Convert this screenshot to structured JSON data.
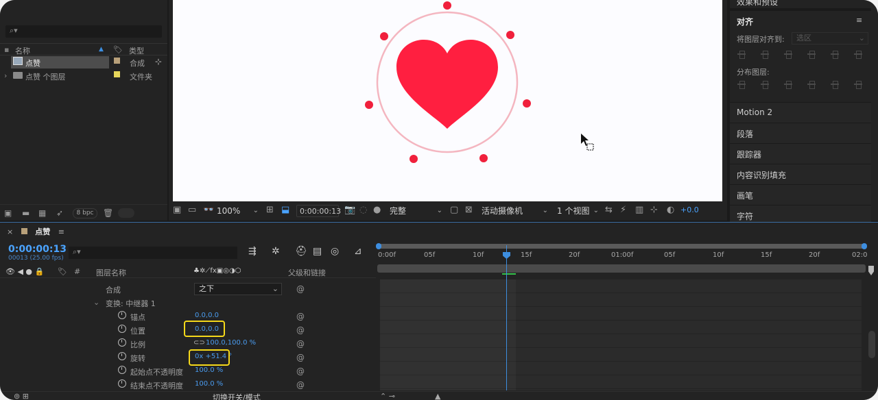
{
  "project": {
    "search_placeholder": "",
    "col_name": "名称",
    "col_type": "类型",
    "items": [
      {
        "name": "点赞",
        "type": "合成",
        "label_color": "#b8a07a"
      },
      {
        "name": "点赞 个图层",
        "type": "文件夹",
        "label_color": "#e6d65a"
      }
    ],
    "bpc": "8 bpc"
  },
  "viewer": {
    "zoom": "100%",
    "timecode": "0:00:00:13",
    "resolution": "完整",
    "camera": "活动摄像机",
    "views": "1 个视图",
    "exposure": "+0.0",
    "heart_color": "#ff1f40",
    "ring_color": "#f4b6c0"
  },
  "right": {
    "top_partial": "效果和预设",
    "align_title": "对齐",
    "align_to_label": "将图层对齐到:",
    "align_to_value": "选区",
    "distribute_label": "分布图层:",
    "sections": [
      "Motion 2",
      "段落",
      "跟踪器",
      "内容识别填充",
      "画笔",
      "字符"
    ]
  },
  "timeline": {
    "comp_name": "点赞",
    "timecode": "0:00:00:13",
    "frames": "00013 (25.00 fps)",
    "col_layer_name": "图层名称",
    "col_parent": "父级和链接",
    "col_num": "#",
    "composite_label": "合成",
    "composite_value": "之下",
    "transform_label": "变换: 中继器 1",
    "props": [
      {
        "name": "锚点",
        "value": "0.0,0.0"
      },
      {
        "name": "位置",
        "value": "0.0,0.0"
      },
      {
        "name": "比例",
        "value": "100.0,100.0 %"
      },
      {
        "name": "旋转",
        "value": "0x +51.4 °"
      },
      {
        "name": "起始点不透明度",
        "value": "100.0 %"
      },
      {
        "name": "结束点不透明度",
        "value": "100.0 %"
      }
    ],
    "ruler_ticks": [
      "0:00f",
      "05f",
      "10f",
      "15f",
      "20f",
      "01:00f",
      "05f",
      "10f",
      "15f",
      "20f",
      "02:0"
    ],
    "footer_mode": "切换开关/模式"
  }
}
